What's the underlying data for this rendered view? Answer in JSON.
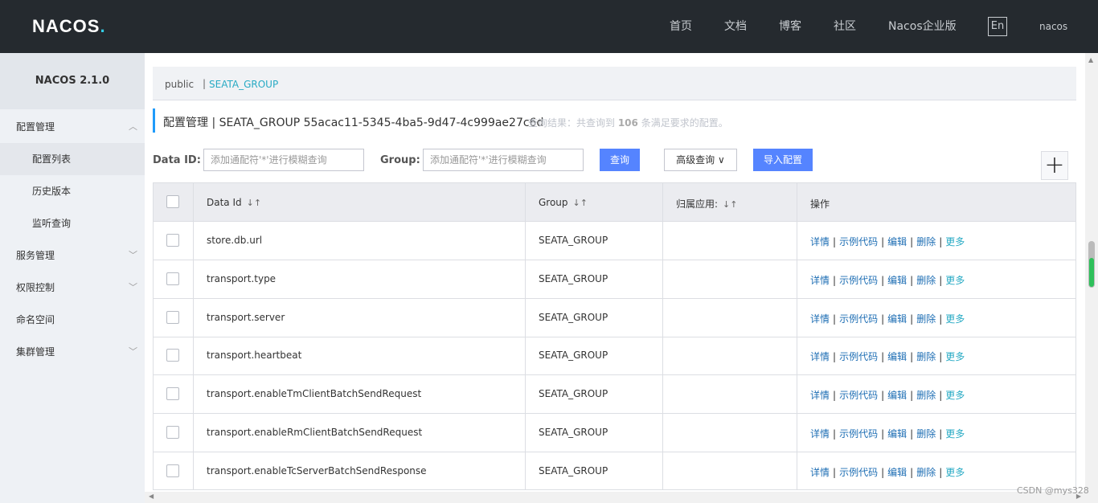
{
  "header": {
    "logo_text": "NACOS",
    "logo_dot": ".",
    "nav": [
      "首页",
      "文档",
      "博客",
      "社区",
      "Nacos企业版"
    ],
    "lang": "En",
    "user": "nacos"
  },
  "sidebar": {
    "version": "NACOS 2.1.0",
    "items": [
      {
        "label": "配置管理"
      },
      {
        "label": "配置列表"
      },
      {
        "label": "历史版本"
      },
      {
        "label": "监听查询"
      },
      {
        "label": "服务管理"
      },
      {
        "label": "权限控制"
      },
      {
        "label": "命名空间"
      },
      {
        "label": "集群管理"
      }
    ]
  },
  "breadcrumb": {
    "namespace": "public",
    "separator": "|",
    "group": "SEATA_GROUP"
  },
  "title": {
    "text": "配置管理 | SEATA_GROUP 55acac11-5345-4ba5-9d47-4c999ae27c6d",
    "result_prefix": "查询结果：共查询到 ",
    "result_count": "106",
    "result_suffix": " 条满足要求的配置。"
  },
  "filters": {
    "data_id_label": "Data ID:",
    "data_id_placeholder": "添加通配符'*'进行模糊查询",
    "group_label": "Group:",
    "group_placeholder": "添加通配符'*'进行模糊查询",
    "search_button": "查询",
    "advanced_button": "高级查询",
    "advanced_chevron": "∨",
    "import_button": "导入配置",
    "add_button": "+"
  },
  "table": {
    "headers": {
      "data_id": "Data Id",
      "group": "Group",
      "app": "归属应用:",
      "ops": "操作"
    },
    "sort_icon": "↓↑",
    "rows": [
      {
        "data_id": "store.db.url",
        "group": "SEATA_GROUP"
      },
      {
        "data_id": "transport.type",
        "group": "SEATA_GROUP"
      },
      {
        "data_id": "transport.server",
        "group": "SEATA_GROUP"
      },
      {
        "data_id": "transport.heartbeat",
        "group": "SEATA_GROUP"
      },
      {
        "data_id": "transport.enableTmClientBatchSendRequest",
        "group": "SEATA_GROUP"
      },
      {
        "data_id": "transport.enableRmClientBatchSendRequest",
        "group": "SEATA_GROUP"
      },
      {
        "data_id": "transport.enableTcServerBatchSendResponse",
        "group": "SEATA_GROUP"
      }
    ],
    "ops": {
      "detail": "详情",
      "sample": "示例代码",
      "edit": "编辑",
      "delete": "删除",
      "more": "更多",
      "sep": "|"
    }
  },
  "watermark": "CSDN @mys328"
}
